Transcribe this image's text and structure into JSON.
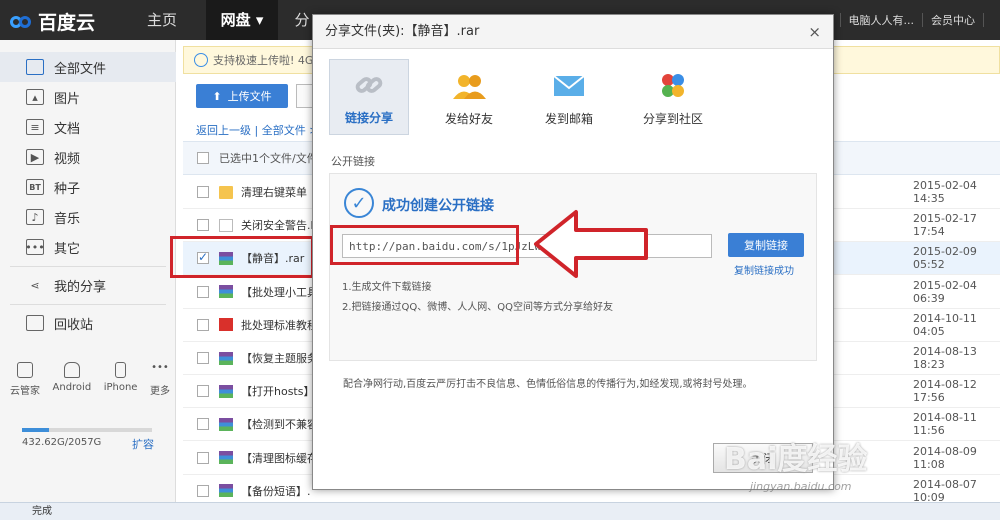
{
  "brand": {
    "name": "百度云"
  },
  "nav": {
    "items": [
      "主页",
      "网盘",
      "分"
    ]
  },
  "top_right": {
    "user": "电脑人人有...",
    "member": "会员中心"
  },
  "sidebar": {
    "items": [
      {
        "label": "全部文件",
        "icon": "folder-icon"
      },
      {
        "label": "图片",
        "icon": "image-icon"
      },
      {
        "label": "文档",
        "icon": "document-icon"
      },
      {
        "label": "视频",
        "icon": "video-icon"
      },
      {
        "label": "种子",
        "icon": "torrent-icon"
      },
      {
        "label": "音乐",
        "icon": "music-icon"
      },
      {
        "label": "其它",
        "icon": "more-icon"
      },
      {
        "label": "我的分享",
        "icon": "share-icon"
      },
      {
        "label": "回收站",
        "icon": "trash-icon"
      }
    ],
    "devices": [
      "云管家",
      "Android",
      "iPhone",
      "更多"
    ],
    "quota": {
      "text": "432.62G/2057G",
      "fraction": 0.21,
      "expand": "扩容"
    }
  },
  "main": {
    "notice": "支持极速上传啦! 4G",
    "upload": "上传文件",
    "breadcrumb": "返回上一级 | 全部文件 >",
    "selection": "已选中1个文件/文件",
    "files": [
      {
        "name": "清理右键菜单",
        "type": "folder",
        "date": "2015-02-04 14:35"
      },
      {
        "name": "关闭安全警告.b",
        "type": "generic",
        "date": "2015-02-17 17:54"
      },
      {
        "name": "【静音】.rar",
        "type": "rar",
        "date": "2015-02-09 05:52",
        "selected": true
      },
      {
        "name": "【批处理小工具",
        "type": "rar",
        "date": "2015-02-04 06:39"
      },
      {
        "name": "批处理标准教程",
        "type": "pdf",
        "date": "2014-10-11 04:05"
      },
      {
        "name": "【恢复主题服务",
        "type": "rar",
        "date": "2014-08-13 18:23"
      },
      {
        "name": "【打开hosts】",
        "type": "rar",
        "date": "2014-08-12 17:56"
      },
      {
        "name": "【检测到不兼容",
        "type": "rar",
        "date": "2014-08-11 11:56"
      },
      {
        "name": "【清理图标缓存",
        "type": "rar",
        "date": "2014-08-09 11:08"
      },
      {
        "name": "【备份短语】.",
        "type": "rar",
        "date": "2014-08-07 10:09"
      }
    ]
  },
  "status": "完成",
  "dialog": {
    "title": "分享文件(夹):【静音】.rar",
    "close": "×",
    "tabs": [
      "链接分享",
      "发给好友",
      "发到邮箱",
      "分享到社区"
    ],
    "public_label": "公开链接",
    "success": "成功创建公开链接",
    "link": "http://pan.baidu.com/s/1pJzLw3D",
    "copy": "复制链接",
    "copy_ok": "复制链接成功",
    "tips": [
      "1.生成文件下载链接",
      "2.把链接通过QQ、微博、人人网、QQ空间等方式分享给好友"
    ],
    "footer": "配合净网行动,百度云严厉打击不良信息、色情低俗信息的传播行为,如经发现,或将封号处理。",
    "close_button": "关闭"
  },
  "watermark": {
    "text": "Bai度经验",
    "sub": "jingyan.baidu.com"
  },
  "colors": {
    "accent": "#3a7fd5",
    "highlight": "#d0242a"
  }
}
